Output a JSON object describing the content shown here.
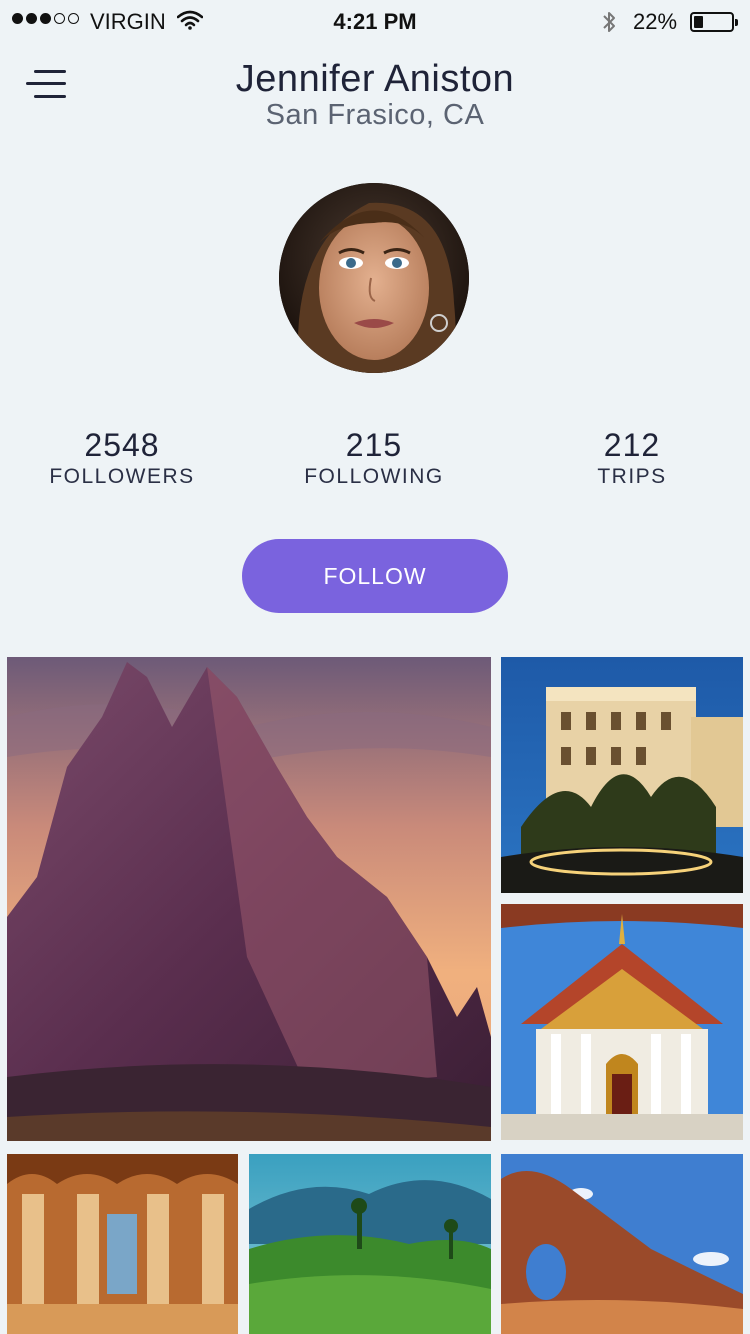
{
  "status_bar": {
    "carrier": "VIRGIN",
    "time": "4:21 PM",
    "battery_pct": "22%",
    "signal_strength": 3,
    "signal_total": 5
  },
  "header": {
    "name": "Jennifer Aniston",
    "location": "San Frasico, CA",
    "menu_icon": "hamburger-menu-icon"
  },
  "stats": [
    {
      "value": "2548",
      "label": "FOLLOWERS"
    },
    {
      "value": "215",
      "label": "FOLLOWING"
    },
    {
      "value": "212",
      "label": "TRIPS"
    }
  ],
  "follow_button": {
    "label": "FOLLOW",
    "color": "#7a63de"
  },
  "photos": [
    {
      "subject": "desert rock spire at sunset"
    },
    {
      "subject": "illuminated palace hotel at dusk"
    },
    {
      "subject": "thai temple"
    },
    {
      "subject": "palace hall with arches"
    },
    {
      "subject": "green hills tea plantation"
    },
    {
      "subject": "red rock arch desert"
    }
  ]
}
